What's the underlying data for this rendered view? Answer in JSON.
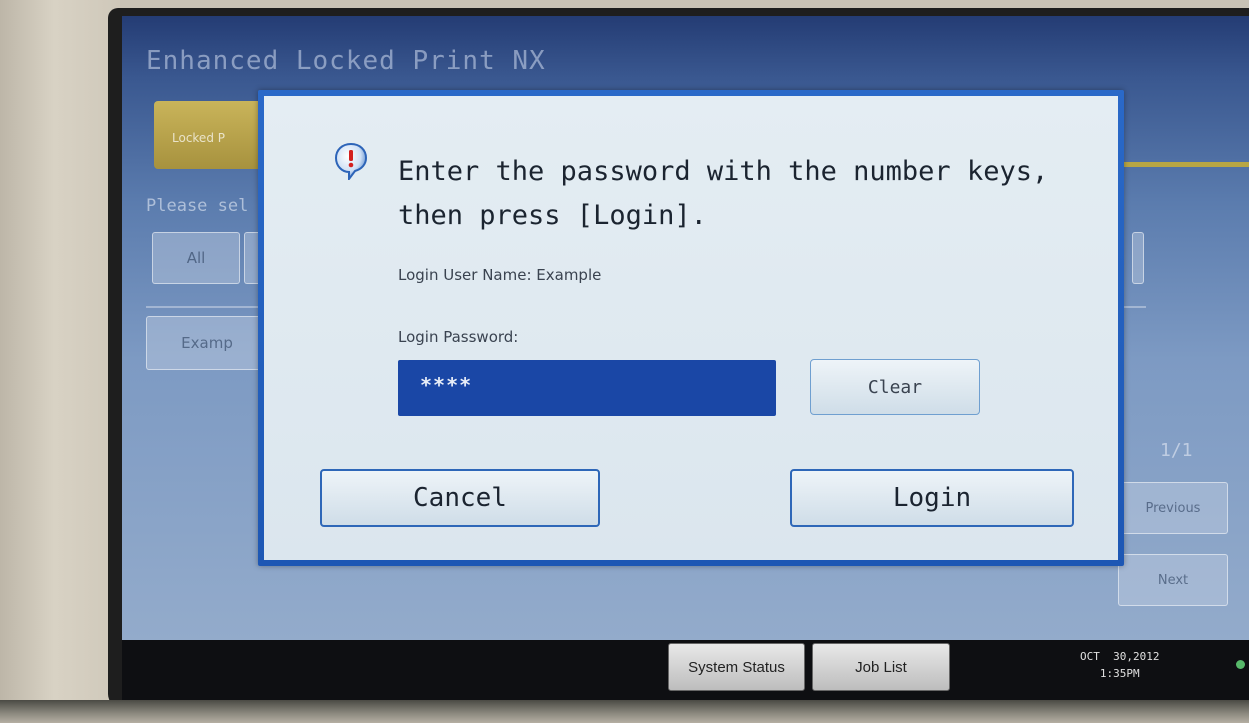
{
  "app": {
    "title": "Enhanced Locked Print NX",
    "tab_label": "Locked P",
    "prompt": "Please sel",
    "filter_all": "All",
    "user_button": "Examp",
    "page_indicator": "1/1",
    "previous_label": "Previous",
    "next_label": "Next"
  },
  "dialog": {
    "icon": "alert-exclamation-icon",
    "message_line1": "Enter the password with the number keys,",
    "message_line2": "then press [Login].",
    "user_name_label": "Login User Name: Example",
    "password_label": "Login Password:",
    "password_value": "****",
    "clear_label": "Clear",
    "cancel_label": "Cancel",
    "login_label": "Login"
  },
  "status_bar": {
    "system_status_label": "System Status",
    "job_list_label": "Job List",
    "date": "OCT  30,2012",
    "time": "1:35PM"
  },
  "colors": {
    "dialog_border": "#2a69c8",
    "dialog_bg": "#e4edf3",
    "password_field": "#1a47a6",
    "screen_bg": "#5b7cae"
  }
}
